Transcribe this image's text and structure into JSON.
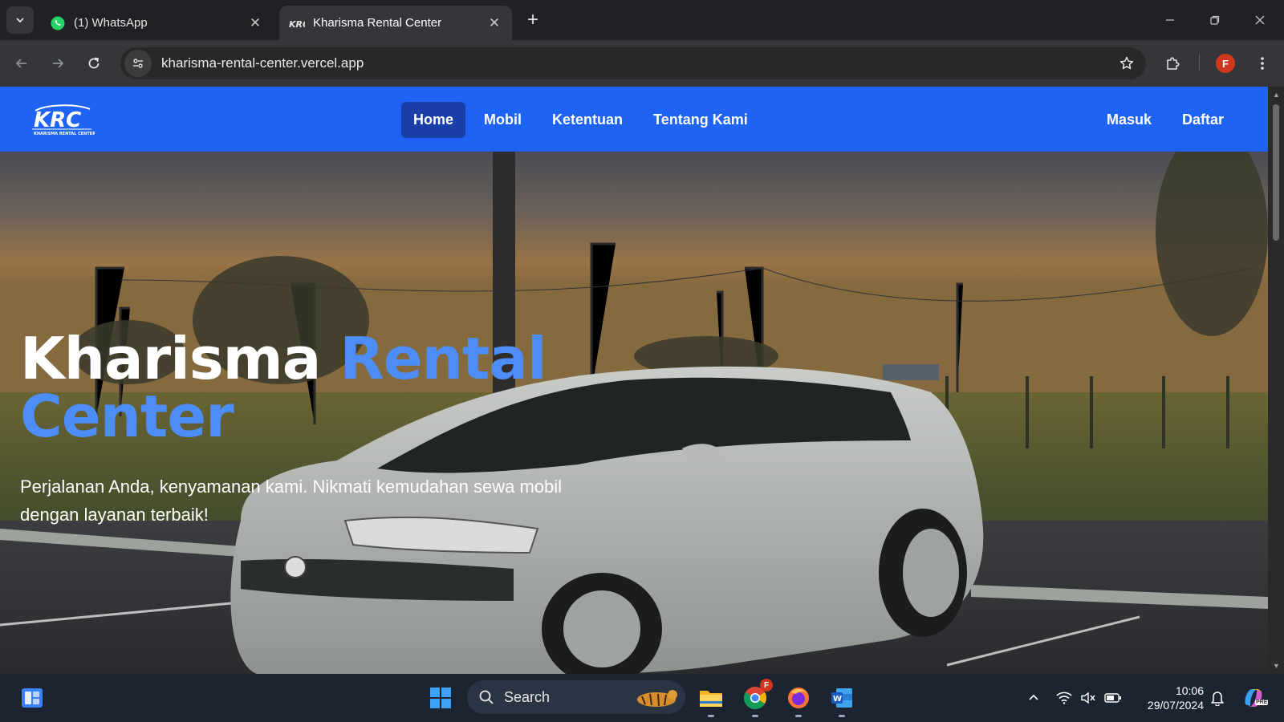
{
  "browser": {
    "tabs": [
      {
        "label": "(1) WhatsApp",
        "icon": "whatsapp-icon",
        "active": false
      },
      {
        "label": "Kharisma Rental Center",
        "icon": "krc-favicon-icon",
        "active": true
      }
    ],
    "url": "kharisma-rental-center.vercel.app",
    "profile_initial": "F"
  },
  "site": {
    "logo_text": "KRC",
    "logo_subtext": "KHARISMA RENTAL CENTER",
    "nav": [
      {
        "label": "Home",
        "active": true
      },
      {
        "label": "Mobil",
        "active": false
      },
      {
        "label": "Ketentuan",
        "active": false
      },
      {
        "label": "Tentang Kami",
        "active": false
      }
    ],
    "auth": {
      "login": "Masuk",
      "register": "Daftar"
    },
    "hero": {
      "title_white": "Kharisma ",
      "title_accent_1": "Rental",
      "title_accent_2": "Center",
      "subtitle": "Perjalanan Anda, kenyamanan kami. Nikmati kemudahan sewa mobil dengan layanan terbaik!"
    }
  },
  "taskbar": {
    "search_label": "Search",
    "time": "10:06",
    "date": "29/07/2024",
    "chrome_badge": "F",
    "copilot_badge": "PRE"
  },
  "colors": {
    "nav_blue": "#1e63f4",
    "nav_active": "#1a3fa8",
    "accent_blue": "#4d8df7"
  }
}
